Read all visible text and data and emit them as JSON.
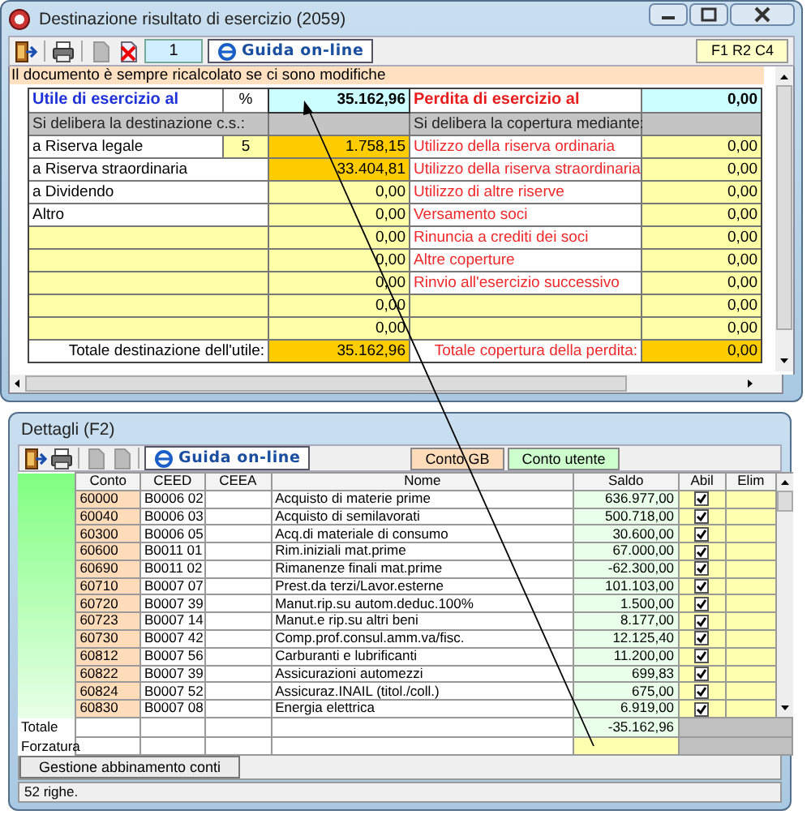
{
  "main_window": {
    "title": "Destinazione risultato di esercizio (2059)",
    "toolbar": {
      "page": "1",
      "help": "Guida on-line",
      "cell_ref": "F1 R2 C4"
    },
    "notice": "Il documento è sempre ricalcolato se ci sono modifiche",
    "summary": {
      "profit_label": "Utile di esercizio al",
      "percent_header": "%",
      "profit_value": "35.162,96",
      "loss_label": "Perdita di esercizio al",
      "loss_value": "0,00",
      "allocation_header": "Si delibera la destinazione c.s.:",
      "coverage_header": "Si delibera la copertura mediante:",
      "allocations": [
        {
          "label": "a Riserva legale",
          "percent": "5",
          "value": "1.758,15",
          "highlighted": true
        },
        {
          "label": "a Riserva straordinaria",
          "value": "33.404,81",
          "highlighted": true
        },
        {
          "label": "a Dividendo",
          "value": "0,00",
          "highlighted": false
        },
        {
          "label": "Altro",
          "value": "0,00",
          "highlighted": false
        },
        {
          "value": "0,00",
          "highlighted": false
        },
        {
          "value": "0,00",
          "highlighted": false
        },
        {
          "value": "0,00",
          "highlighted": false
        },
        {
          "value": "0,00",
          "highlighted": false
        },
        {
          "value": "0,00",
          "highlighted": false
        }
      ],
      "coverage": [
        {
          "label": "Utilizzo della riserva ordinaria",
          "value": "0,00"
        },
        {
          "label": "Utilizzo della riserva straordinaria",
          "value": "0,00"
        },
        {
          "label": "Utilizzo di altre riserve",
          "value": "0,00"
        },
        {
          "label": "Versamento soci",
          "value": "0,00"
        },
        {
          "label": "Rinuncia a crediti dei soci",
          "value": "0,00"
        },
        {
          "label": "Altre coperture",
          "value": "0,00"
        },
        {
          "label": "Rinvio all'esercizio successivo",
          "value": "0,00"
        },
        {
          "value": "0,00"
        },
        {
          "value": "0,00"
        }
      ],
      "total_allocation_label": "Totale destinazione dell'utile:",
      "total_allocation_value": "35.162,96",
      "total_coverage_label": "Totale copertura della perdita:",
      "total_coverage_value": "0,00"
    }
  },
  "details": {
    "title": "Dettagli (F2)",
    "help": "Guida on-line",
    "legends": [
      {
        "label": "Conto GB",
        "color": "#ffdcb9"
      },
      {
        "label": "Conto utente",
        "color": "#ccffcc"
      }
    ],
    "columns": [
      "Conto",
      "CEED",
      "CEEA",
      "Nome",
      "Saldo",
      "Abil",
      "Elim"
    ],
    "rows": [
      {
        "conto": "60000",
        "ceed": "B0006 02",
        "nome": "Acquisto di materie prime",
        "saldo": "636.977,00",
        "abil": true
      },
      {
        "conto": "60040",
        "ceed": "B0006 03",
        "nome": "Acquisto di semilavorati",
        "saldo": "500.718,00",
        "abil": true
      },
      {
        "conto": "60300",
        "ceed": "B0006 05",
        "nome": "Acq.di materiale di consumo",
        "saldo": "30.600,00",
        "abil": true
      },
      {
        "conto": "60600",
        "ceed": "B0011 01",
        "nome": "Rim.iniziali mat.prime",
        "saldo": "67.000,00",
        "abil": true
      },
      {
        "conto": "60690",
        "ceed": "B0011 02",
        "nome": "Rimanenze finali mat.prime",
        "saldo": "-62.300,00",
        "abil": true
      },
      {
        "conto": "60710",
        "ceed": "B0007 07",
        "nome": "Prest.da terzi/Lavor.esterne",
        "saldo": "101.103,00",
        "abil": true
      },
      {
        "conto": "60720",
        "ceed": "B0007 39",
        "nome": "Manut.rip.su autom.deduc.100%",
        "saldo": "1.500,00",
        "abil": true
      },
      {
        "conto": "60723",
        "ceed": "B0007 14",
        "nome": "Manut.e rip.su altri beni",
        "saldo": "8.177,00",
        "abil": true
      },
      {
        "conto": "60730",
        "ceed": "B0007 42",
        "nome": "Comp.prof.consul.amm.va/fisc.",
        "saldo": "12.125,40",
        "abil": true
      },
      {
        "conto": "60812",
        "ceed": "B0007 56",
        "nome": "Carburanti e lubrificanti",
        "saldo": "11.200,00",
        "abil": true
      },
      {
        "conto": "60822",
        "ceed": "B0007 39",
        "nome": "Assicurazioni automezzi",
        "saldo": "699,83",
        "abil": true
      },
      {
        "conto": "60824",
        "ceed": "B0007 52",
        "nome": "Assicuraz.INAIL (titol./coll.)",
        "saldo": "675,00",
        "abil": true
      },
      {
        "conto": "60830",
        "ceed": "B0007 08",
        "nome": "Energia elettrica",
        "saldo": "6.919,00",
        "abil": true
      }
    ],
    "total_label": "Totale",
    "total_saldo": "-35.162,96",
    "override_label": "Forzatura",
    "button": "Gestione abbinamento conti",
    "status": "52 righe."
  }
}
